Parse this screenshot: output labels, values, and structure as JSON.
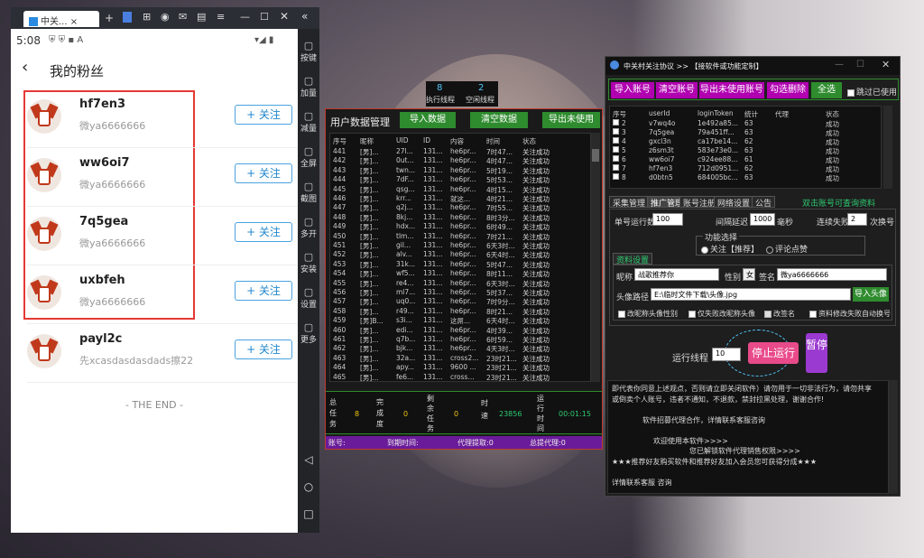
{
  "emulator": {
    "tab_title": "中关...",
    "side_buttons": [
      {
        "label": "按键",
        "icon": "keyboard-icon"
      },
      {
        "label": "加量",
        "icon": "volume-up-icon"
      },
      {
        "label": "减量",
        "icon": "volume-down-icon"
      },
      {
        "label": "全屏",
        "icon": "fullscreen-icon"
      },
      {
        "label": "截图",
        "icon": "scissors-icon"
      },
      {
        "label": "多开",
        "icon": "multi-instance-icon"
      },
      {
        "label": "安装",
        "icon": "apk-icon"
      },
      {
        "label": "设置",
        "icon": "settings-icon"
      },
      {
        "label": "更多",
        "icon": "more-icon"
      }
    ]
  },
  "phone": {
    "time": "5:08",
    "title": "我的粉丝",
    "follow_label": "+ 关注",
    "followers": [
      {
        "name": "hf7en3",
        "sub": "微ya6666666"
      },
      {
        "name": "ww6oi7",
        "sub": "微ya6666666"
      },
      {
        "name": "7q5gea",
        "sub": "微ya6666666"
      },
      {
        "name": "uxbfeh",
        "sub": "微ya6666666"
      },
      {
        "name": "payl2c",
        "sub": "先xcasdasdasdads擦22"
      }
    ],
    "end_text": "- THE END -"
  },
  "threads": {
    "exec_label": "执行线程",
    "exec_value": "8",
    "idle_label": "空闲线程",
    "idle_value": "2"
  },
  "middle": {
    "title": "用户数据管理",
    "btn_import": "导入数据",
    "btn_clear": "清空数据",
    "btn_export": "导出未使用",
    "columns": [
      "序号",
      "昵称",
      "UID",
      "ID",
      "内容",
      "时间",
      "状态"
    ],
    "rows": [
      [
        "441",
        "[男]...",
        "27l...",
        "131...",
        "he6pr...",
        "7时47...",
        "关注成功"
      ],
      [
        "442",
        "[男]...",
        "0ut...",
        "131...",
        "he6pr...",
        "4时47...",
        "关注成功"
      ],
      [
        "443",
        "[男]...",
        "twn...",
        "131...",
        "he6pr...",
        "5时19...",
        "关注成功"
      ],
      [
        "444",
        "[男]...",
        "7dF...",
        "131...",
        "he6pr...",
        "5时53...",
        "关注成功"
      ],
      [
        "445",
        "[男]...",
        "qsg...",
        "131...",
        "he6pr...",
        "4时15...",
        "关注成功"
      ],
      [
        "446",
        "[男]...",
        "krr...",
        "131...",
        "就这...",
        "4时21...",
        "关注成功"
      ],
      [
        "447",
        "[男]...",
        "q2j...",
        "131...",
        "he6pr...",
        "7时55...",
        "关注成功"
      ],
      [
        "448",
        "[男]...",
        "8kj...",
        "131...",
        "he6pr...",
        "8时3分...",
        "关注成功"
      ],
      [
        "449",
        "[男]...",
        "hdx...",
        "131...",
        "he6pr...",
        "6时49...",
        "关注成功"
      ],
      [
        "450",
        "[男]...",
        "tlm...",
        "131...",
        "he6pr...",
        "7时21...",
        "关注成功"
      ],
      [
        "451",
        "[男]...",
        "gil...",
        "131...",
        "he6pr...",
        "6天3时...",
        "关注成功"
      ],
      [
        "452",
        "[男]...",
        "alv...",
        "131...",
        "he6pr...",
        "6天4时...",
        "关注成功"
      ],
      [
        "453",
        "[男]...",
        "31k...",
        "131...",
        "he6pr...",
        "5时47...",
        "关注成功"
      ],
      [
        "454",
        "[男]...",
        "wf5...",
        "131...",
        "he6pr...",
        "8时11...",
        "关注成功"
      ],
      [
        "455",
        "[男]...",
        "re4...",
        "131...",
        "he6pr...",
        "6天3时...",
        "关注成功"
      ],
      [
        "456",
        "[男]...",
        "ml7...",
        "131...",
        "he6pr...",
        "5时37...",
        "关注成功"
      ],
      [
        "457",
        "[男]...",
        "uq0...",
        "131...",
        "he6pr...",
        "7时9分...",
        "关注成功"
      ],
      [
        "458",
        "[男]...",
        "r49...",
        "131...",
        "he6pr...",
        "8时21...",
        "关注成功"
      ],
      [
        "459",
        "[男]B...",
        "s3i...",
        "131...",
        "这屌...",
        "6天4时...",
        "关注成功"
      ],
      [
        "460",
        "[男]...",
        "edi...",
        "131...",
        "he6pr...",
        "4时39...",
        "关注成功"
      ],
      [
        "461",
        "[男]...",
        "q7b...",
        "131...",
        "he6pr...",
        "6时59...",
        "关注成功"
      ],
      [
        "462",
        "[男]...",
        "bjk...",
        "131...",
        "he6pr...",
        "4天3时...",
        "关注成功"
      ],
      [
        "463",
        "[男]...",
        "32a...",
        "131...",
        "cross2...",
        "23时21...",
        "关注成功"
      ],
      [
        "464",
        "[男]...",
        "apy...",
        "131...",
        "9600 ...",
        "23时21...",
        "关注成功"
      ],
      [
        "465",
        "[男]...",
        "fe6...",
        "131...",
        "cross...",
        "23时21...",
        "关注成功"
      ]
    ],
    "stats": {
      "total_label": "总任务",
      "total_value": "8",
      "done_label": "完成度",
      "done_value": "0",
      "remain_label": "剩余任务",
      "remain_value": "0",
      "speed_label": "时速",
      "speed_value": "23856",
      "runtime_label": "运行时间",
      "runtime_value": "00:01:15"
    },
    "footer": {
      "account": "账号:",
      "expire": "到期时间:",
      "agent": "代理提取:0",
      "total_agent": "总提代理:0"
    }
  },
  "right": {
    "title": "中关村关注协议 >> 【接软件或功能定制】",
    "btns": [
      "导入账号",
      "清空账号",
      "导出未使用账号",
      "勾选删除",
      "全选"
    ],
    "skip_used": "跳过已使用",
    "columns": [
      "序号",
      "userId",
      "loginToken",
      "统计",
      "代理",
      "状态"
    ],
    "accounts": [
      [
        "2",
        "v7wq4o",
        "1e492a85...",
        "63",
        "",
        "成功"
      ],
      [
        "3",
        "7q5gea",
        "79a451ff...",
        "63",
        "",
        "成功"
      ],
      [
        "4",
        "gxcl3n",
        "ca17be14...",
        "62",
        "",
        "成功"
      ],
      [
        "5",
        "z6sm3t",
        "583e73e0...",
        "63",
        "",
        "成功"
      ],
      [
        "6",
        "ww6oi7",
        "c924ee88...",
        "61",
        "",
        "成功"
      ],
      [
        "7",
        "hf7en3",
        "712d0951...",
        "62",
        "",
        "成功"
      ],
      [
        "8",
        "d0btn5",
        "684005bc...",
        "63",
        "",
        "成功"
      ]
    ],
    "tabs": [
      "采集管理",
      "推广管理",
      "账号注册",
      "网络设置",
      "公告"
    ],
    "promo": "双击账号可查询资料",
    "single_label": "单号运行数",
    "single_value": "100",
    "interval_label": "间隔延迟",
    "interval_value": "1000",
    "ms": "毫秒",
    "fail_label": "连续失败",
    "fail_value": "2",
    "switch": "次换号",
    "func_group": "功能选择",
    "opt1": "关注【推荐】",
    "opt2": "评论点赞",
    "profile_tab": "资料设置",
    "nick_label": "昵称",
    "nick_value": "战歌推荐你",
    "gender_label": "性别",
    "gender_value": "女",
    "sign_label": "签名",
    "sign_value": "微ya6666666",
    "avatar_label": "头像路径",
    "avatar_value": "E:\\临时文件下载\\头像.jpg",
    "import_avatar": "导入头像",
    "chk1": "改昵称头像性别",
    "chk2": "仅失败改昵称头像",
    "chk3": "改签名",
    "chk4": "资料修改失败自动换号",
    "run_label": "运行线程",
    "run_value": "10",
    "stop_btn": "停止运行",
    "pause_btn": "暂停",
    "notice": [
      "即代表你同意上述观点，否则请立即关闭软件）请勿用于一切非法行为，请勿共享",
      "或倒卖个人账号，违者不通知，不退款，禁封拉黑处理，谢谢合作!",
      "",
      "软件招募代理合作，详情联系客服咨询",
      "",
      "欢迎使用本软件>>>>",
      "您已解锁软件代理销售权限>>>>",
      "★★★推荐好友购买软件和推荐好友加入会员您可获得分成★★★",
      "",
      "详情联系客服  咨询"
    ]
  }
}
